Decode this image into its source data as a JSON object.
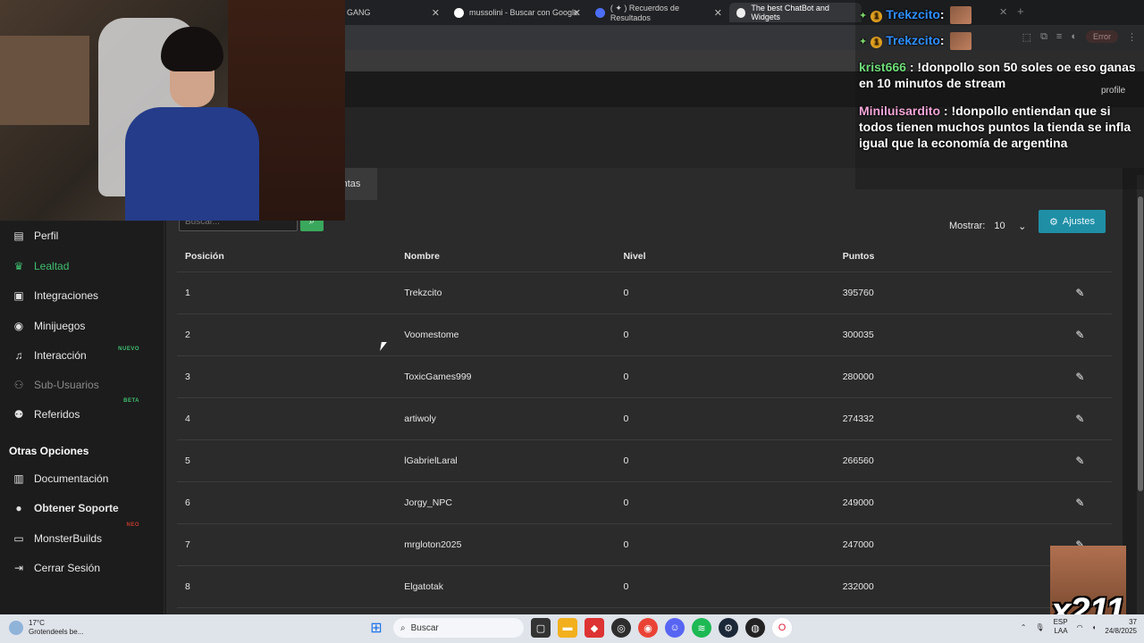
{
  "browser": {
    "tabs": [
      {
        "label": "GANG",
        "active": false
      },
      {
        "label": "mussolini - Buscar con Google",
        "active": false
      },
      {
        "label": "( ✦ ) Recuerdos de Resultados",
        "active": false
      },
      {
        "label": "The best ChatBot and Widgets",
        "active": true
      }
    ],
    "error_label": "Error"
  },
  "subtab": {
    "label": "ntas"
  },
  "search": {
    "placeholder": "Buscar..."
  },
  "mostrar": {
    "label": "Mostrar:",
    "value": "10"
  },
  "ajustes": {
    "label": "Ajustes"
  },
  "sidebar": {
    "items": [
      {
        "label": "Perfil",
        "icon": "id-card-icon"
      },
      {
        "label": "Lealtad",
        "icon": "trophy-icon"
      },
      {
        "label": "Integraciones",
        "icon": "puzzle-icon"
      },
      {
        "label": "Minijuegos",
        "icon": "gamepad-icon"
      },
      {
        "label": "Interacción",
        "icon": "music-icon",
        "badge": "NUEVO"
      },
      {
        "label": "Sub-Usuarios",
        "icon": "users-icon"
      },
      {
        "label": "Referidos",
        "icon": "referrals-icon",
        "badge": "BETA"
      }
    ],
    "section_title": "Otras Opciones",
    "other": [
      {
        "label": "Documentación",
        "icon": "book-icon"
      },
      {
        "label": "Obtener Soporte",
        "icon": "support-icon"
      },
      {
        "label": "MonsterBuilds",
        "icon": "laptop-icon",
        "badge": "NEO"
      },
      {
        "label": "Cerrar Sesión",
        "icon": "logout-icon"
      }
    ]
  },
  "table": {
    "headers": [
      "Posición",
      "Nombre",
      "Nivel",
      "Puntos"
    ],
    "rows": [
      {
        "pos": "1",
        "name": "Trekzcito",
        "level": "0",
        "points": "395760"
      },
      {
        "pos": "2",
        "name": "Voomestome",
        "level": "0",
        "points": "300035"
      },
      {
        "pos": "3",
        "name": "ToxicGames999",
        "level": "0",
        "points": "280000"
      },
      {
        "pos": "4",
        "name": "artiwoly",
        "level": "0",
        "points": "274332"
      },
      {
        "pos": "5",
        "name": "lGabrielLaral",
        "level": "0",
        "points": "266560"
      },
      {
        "pos": "6",
        "name": "Jorgy_NPC",
        "level": "0",
        "points": "249000"
      },
      {
        "pos": "7",
        "name": "mrgloton2025",
        "level": "0",
        "points": "247000"
      },
      {
        "pos": "8",
        "name": "Elgatotak",
        "level": "0",
        "points": "232000"
      }
    ]
  },
  "chat": {
    "lines": [
      {
        "user": "Trekzcito",
        "sep": ":"
      },
      {
        "user": "Trekzcito",
        "sep": ":"
      },
      {
        "user": "krist666",
        "text": " : !donpollo son 50 soles oe eso ganas en 10 minutos de stream"
      },
      {
        "user": "Miniluisardito",
        "text": " : !donpollo entiendan que si todos tienen muchos puntos la tienda se infla igual que la economía de argentina"
      }
    ],
    "profile_label": "profile"
  },
  "emote": {
    "count": "x211"
  },
  "taskbar": {
    "weather_temp": "17°C",
    "weather_desc": "Grotendeels be...",
    "search_label": "Buscar",
    "lang_top": "ESP",
    "lang_bottom": "LAA",
    "time": "37",
    "date": "24/8/2025"
  },
  "colors": {
    "accent_green": "#3fbf6f",
    "ajustes_bg": "#1f8fa6",
    "search_btn": "#3aa85c"
  }
}
